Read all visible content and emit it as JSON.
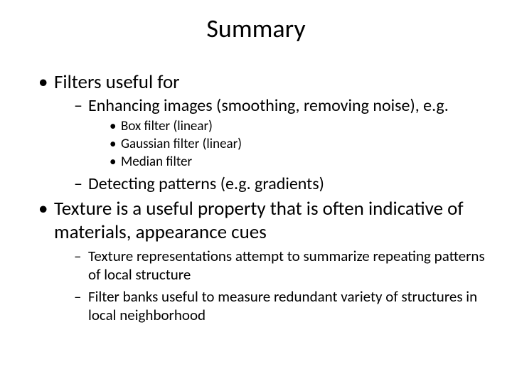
{
  "title": "Summary",
  "bullets": [
    {
      "text": "Filters useful for",
      "children": [
        {
          "text": "Enhancing images (smoothing, removing noise), e.g.",
          "children": [
            {
              "text": "Box filter (linear)"
            },
            {
              "text": "Gaussian filter (linear)"
            },
            {
              "text": "Median filter"
            }
          ]
        },
        {
          "text": "Detecting patterns (e.g. gradients)"
        }
      ]
    },
    {
      "text": "Texture is a useful property that is often indicative of materials, appearance cues",
      "children2": [
        {
          "text": "Texture representations attempt to summarize repeating patterns of local structure"
        },
        {
          "text": "Filter banks useful to measure redundant variety of structures in local neighborhood"
        }
      ]
    }
  ]
}
